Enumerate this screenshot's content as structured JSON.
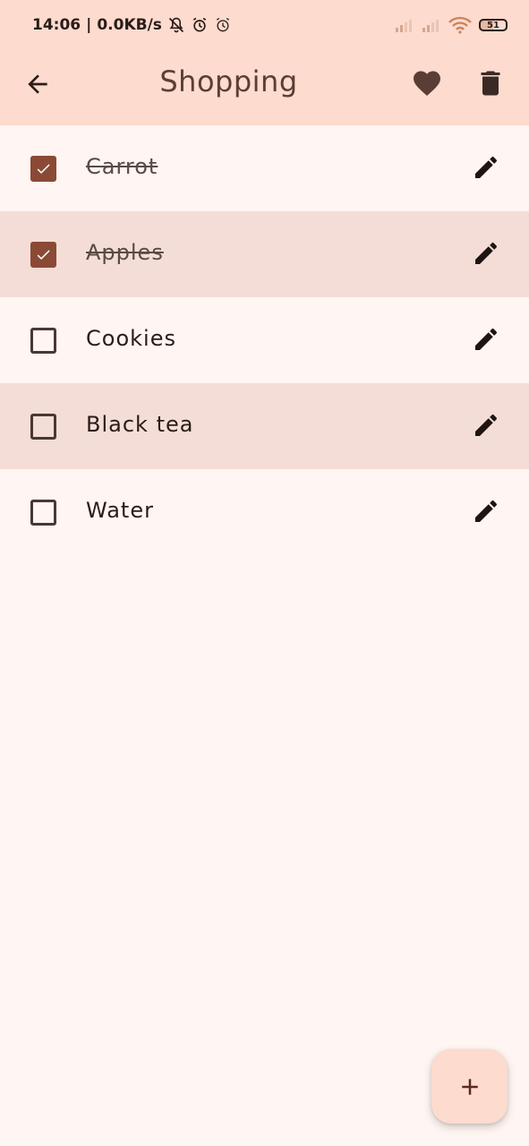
{
  "status_bar": {
    "time": "14:06",
    "net_speed": "0.0KB/s",
    "battery": "51",
    "icons": [
      "mute-bell-icon",
      "alarm-icon",
      "alarm-outline-icon",
      "signal-icon",
      "signal-icon",
      "wifi-icon",
      "battery-icon"
    ]
  },
  "app_bar": {
    "title": "Shopping",
    "back_icon": "arrow-left-icon",
    "favorite_icon": "heart-icon",
    "delete_icon": "trash-icon"
  },
  "items": [
    {
      "label": "Carrot",
      "checked": true
    },
    {
      "label": "Apples",
      "checked": true
    },
    {
      "label": "Cookies",
      "checked": false
    },
    {
      "label": "Black tea",
      "checked": false
    },
    {
      "label": "Water",
      "checked": false
    }
  ],
  "fab": {
    "icon": "plus-icon"
  },
  "colors": {
    "header": "#fddbce",
    "background": "#fff5f2",
    "row_alt": "#f5ddd7",
    "checkbox_checked": "#8a4a35",
    "title_text": "#5a3e36"
  }
}
